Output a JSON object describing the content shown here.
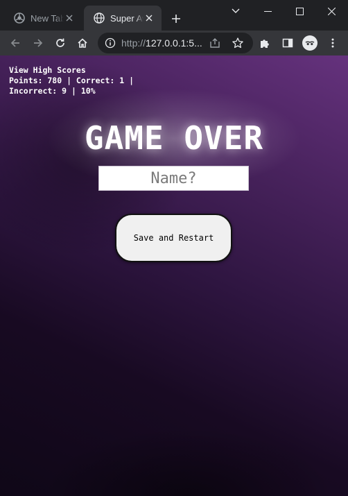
{
  "browser": {
    "tabs": [
      {
        "title": "New Tab",
        "active": false
      },
      {
        "title": "Super Aw",
        "active": true
      }
    ],
    "address": {
      "prefix": "http://",
      "host": "127.0.0.1",
      "rest": ":5..."
    }
  },
  "game": {
    "view_high_scores": "View High Scores",
    "stats_line1": "Points: 780 | Correct: 1 |",
    "stats_line2": "Incorrect: 9 | 10%",
    "title": "GAME OVER",
    "name_placeholder": "Name?",
    "name_value": "",
    "restart_label": "Save and Restart"
  }
}
